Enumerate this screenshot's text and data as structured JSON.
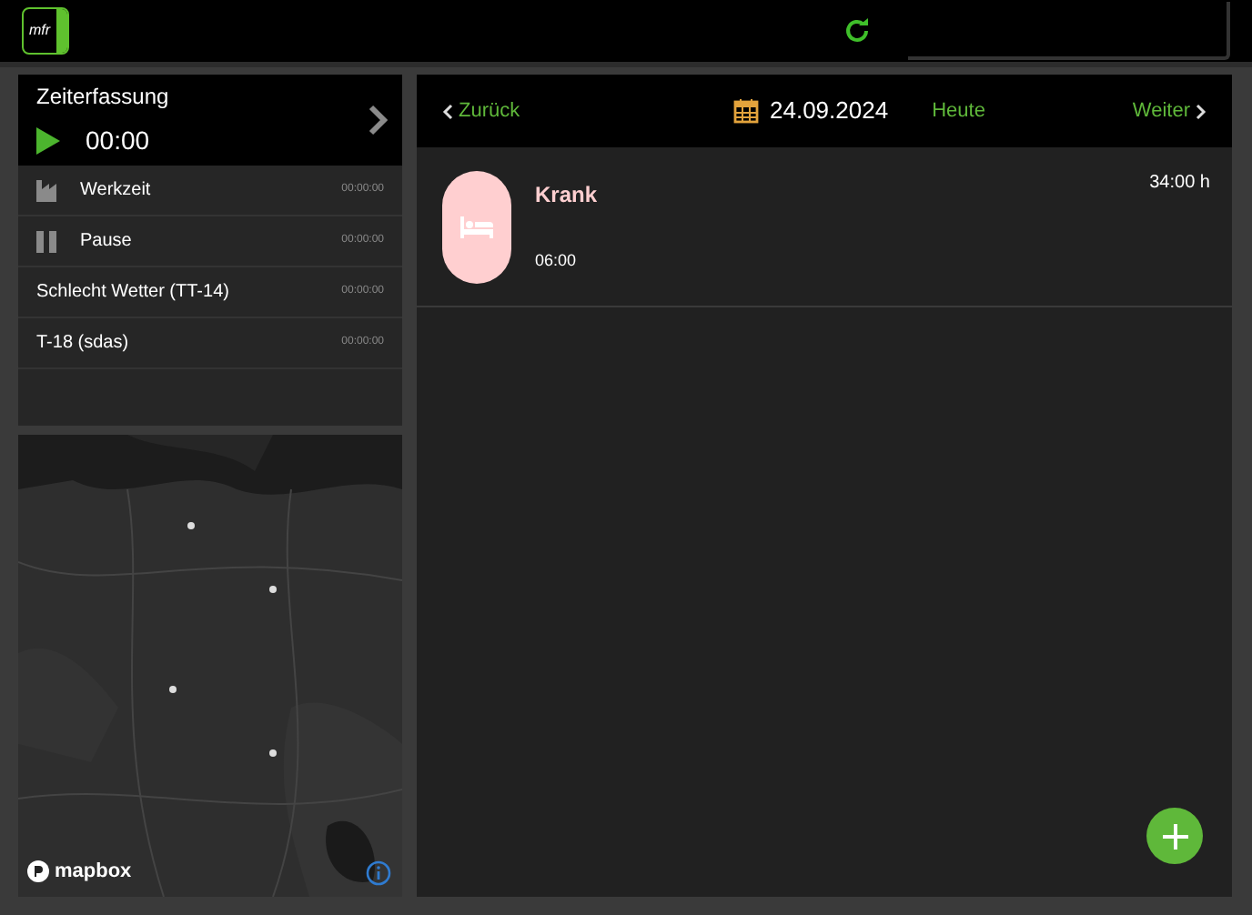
{
  "top_bar": {
    "logo_text": "mfr"
  },
  "timer": {
    "title": "Zeiterfassung",
    "time": "00:00"
  },
  "activities": [
    {
      "kind": "work",
      "label": "Werkzeit",
      "duration": "00:00:00"
    },
    {
      "kind": "pause",
      "label": "Pause",
      "duration": "00:00:00"
    },
    {
      "kind": "plain",
      "label": "Schlecht Wetter (TT-14)",
      "duration": "00:00:00"
    },
    {
      "kind": "plain",
      "label": "T-18 (sdas)",
      "duration": "00:00:00"
    }
  ],
  "map": {
    "attribution": "mapbox"
  },
  "day_nav": {
    "back": "Zurück",
    "date": "24.09.2024",
    "today": "Heute",
    "next": "Weiter"
  },
  "entries": [
    {
      "title": "Krank",
      "time": "06:00",
      "total": "34:00 h",
      "color": "#ffcfd0"
    }
  ]
}
